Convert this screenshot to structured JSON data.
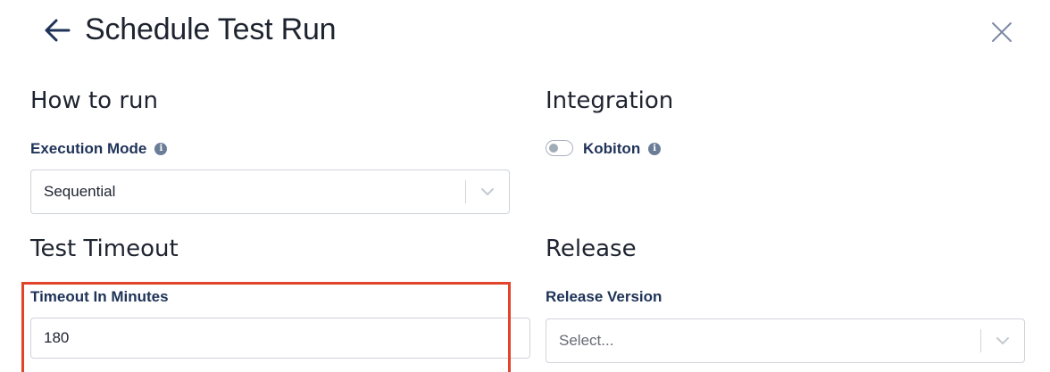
{
  "header": {
    "title": "Schedule Test Run"
  },
  "how_to_run": {
    "heading": "How to run",
    "execution_mode": {
      "label": "Execution Mode",
      "value": "Sequential"
    }
  },
  "integration": {
    "heading": "Integration",
    "kobiton": {
      "label": "Kobiton",
      "enabled": false
    }
  },
  "test_timeout": {
    "heading": "Test Timeout",
    "timeout_minutes": {
      "label": "Timeout In Minutes",
      "value": "180"
    }
  },
  "release": {
    "heading": "Release",
    "release_version": {
      "label": "Release Version",
      "placeholder": "Select..."
    }
  },
  "colors": {
    "label_navy": "#1f3358",
    "highlight_red": "#e0442a",
    "border_gray": "#cfd3d9"
  },
  "icons": {
    "back": "arrow-left-icon",
    "close": "close-icon",
    "info": "info-icon",
    "dropdown": "chevron-down-icon"
  }
}
